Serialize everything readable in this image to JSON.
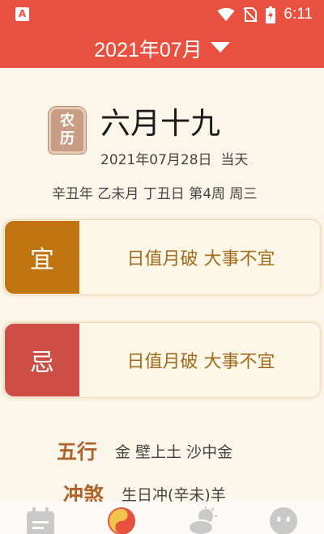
{
  "status_bar": {
    "app_icon": "A",
    "time": "6:11",
    "icons": [
      "wifi-icon",
      "no-sim-icon",
      "battery-charging-icon"
    ]
  },
  "header": {
    "month": "2021年07月",
    "dropdown_icon": "caret-down-icon"
  },
  "day": {
    "badge_top": "农",
    "badge_bottom": "历",
    "lunar_date": "六月十九",
    "solar_date": "2021年07月28日",
    "today_label": "当天",
    "ganzhi": "辛丑年 乙未月 丁丑日 第4周 周三"
  },
  "yi": {
    "tag": "宜",
    "text": "日值月破 大事不宜"
  },
  "ji": {
    "tag": "忌",
    "text": "日值月破 大事不宜"
  },
  "wuxing": {
    "label": "五行",
    "value": "金 壁上土 沙中金"
  },
  "chongsha": {
    "label": "冲煞",
    "value": "生日冲(辛未)羊"
  },
  "bottom_nav": {
    "items": [
      "calendar-icon",
      "yin-yang-icon",
      "weather-icon",
      "face-icon"
    ],
    "active_index": 1,
    "colors": {
      "active": "#e8503f",
      "inactive": "#c9c9c9"
    }
  },
  "colors": {
    "primary": "#e8503f",
    "yi_tag": "#c17510",
    "ji_tag": "#cc4e45",
    "card_text": "#a16a1c",
    "section_label": "#b0622c",
    "background": "#fbf6ea"
  }
}
